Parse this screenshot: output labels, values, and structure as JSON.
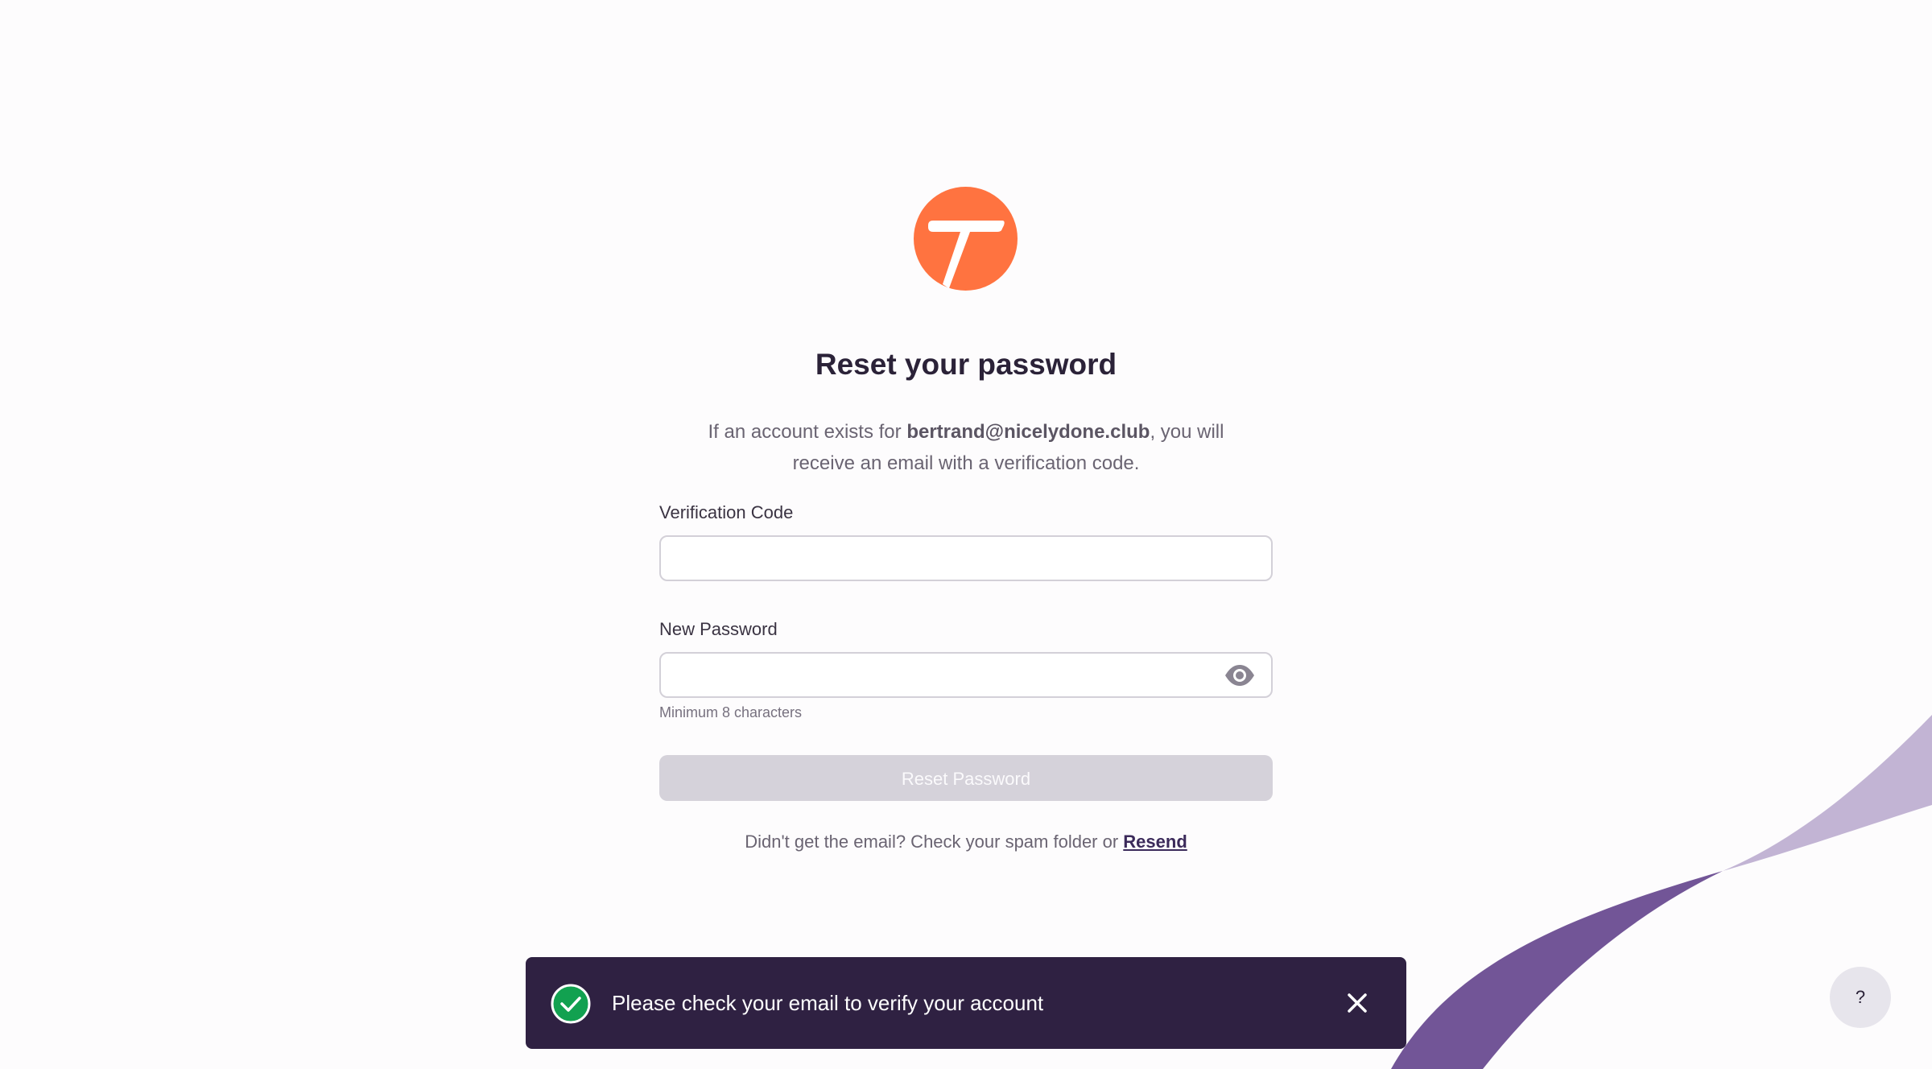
{
  "brand": {
    "logo_icon": "brand-t-logo-icon",
    "accent_color": "#ff7340"
  },
  "reset": {
    "title": "Reset your password",
    "info_prefix": "If an account exists for ",
    "email": "bertrand@nicelydone.club",
    "info_suffix": ", you will receive an email with a verification code.",
    "code_label": "Verification Code",
    "code_value": "",
    "password_label": "New Password",
    "password_value": "",
    "password_hint": "Minimum 8 characters",
    "show_password_icon": "eye-icon",
    "submit_label": "Reset Password",
    "resend_prompt": "Didn't get the email? Check your spam folder or ",
    "resend_link": "Resend"
  },
  "toast": {
    "message": "Please check your email to verify your account",
    "status_icon": "check-circle-icon",
    "status_color": "#12a150",
    "close_icon": "close-icon",
    "background": "#2f2142"
  },
  "help": {
    "label": "?"
  }
}
